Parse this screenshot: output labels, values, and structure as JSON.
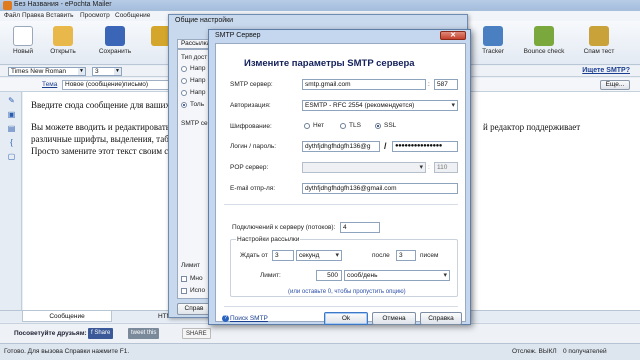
{
  "window": {
    "title": "Без Названия - ePochta Mailer"
  },
  "menu": [
    "Файл",
    "Правка",
    "Вставить",
    "Просмотр",
    "Сообщение"
  ],
  "toolbar": {
    "new": "Новый",
    "open": "Открыть",
    "save": "Сохранить",
    "tracker": "Tracker",
    "bounce_check": "Bounce check",
    "spam_check": "Спам тест"
  },
  "fontbar": {
    "font": "Times New Roman",
    "size": "3",
    "help": "Ищете SMTP?"
  },
  "subject": {
    "label": "Тема",
    "value": "Новое (сообщение)письмо)",
    "more": "Еще..."
  },
  "editor": {
    "line1": "Введите сюда сообщение для ваших",
    "line2": "Вы можете вводить и редактировать",
    "line2b": "й редактор поддерживает",
    "line3": "различные шрифты, выделения, табл",
    "line4": "Просто замените этот текст своим се"
  },
  "bottom_tabs": [
    "Сообщение",
    "HTM"
  ],
  "share": {
    "label": "Посоветуйте друзьям:",
    "facebook": "Share",
    "twitter": "tweet this",
    "addthis": "SHARE"
  },
  "status": {
    "left": "Готово. Для вызова Справки нажмите F1.",
    "mid": "Отслеж. ВЫКЛ",
    "right": "0 получателей"
  },
  "general_dialog": {
    "title": "Общие настройки",
    "tab": "Рассылка",
    "group": "Тип дост",
    "options": [
      "Напр",
      "Напр",
      "Напр",
      "Толь"
    ],
    "smtp_label": "SMTP серв",
    "limit_label": "Лимит",
    "checkboxes": [
      "Мно",
      "Испо"
    ],
    "button": "Справ"
  },
  "smtp_dialog": {
    "title": "SMTP Сервер",
    "heading": "Измените параметры SMTP сервера",
    "server_label": "SMTP сервер:",
    "server_value": "smtp.gmail.com",
    "port_value": "587",
    "auth_label": "Авторизация:",
    "auth_value": "ESMTP - RFC 2554 (рекомендуется)",
    "encryption_label": "Шифрование:",
    "encryption_options": [
      "Нет",
      "TLS",
      "SSL"
    ],
    "encryption_selected": "SSL",
    "login_label": "Логин / пароль:",
    "login_value": "dythfjdhgfhdgfh136@g",
    "password_value": "●●●●●●●●●●●●●●●",
    "pop_label": "POP сервер:",
    "pop_port": "110",
    "email_label": "E-mail отпр-ля:",
    "email_value": "dythfjdhgfhdgfh136@gmail.com",
    "connections_label": "Подключений к серверу (потоков):",
    "connections_value": "4",
    "mailing_group": "Настройки рассылки",
    "wait_label": "Ждать от",
    "wait_value": "3",
    "wait_unit": "секунд",
    "after_label": "после",
    "after_value": "3",
    "after_unit": "писем",
    "limit_label": "Лимит:",
    "limit_value": "500",
    "limit_unit": "сооб/день",
    "hint": "(или оставьте 0, чтобы пропустить опцию)",
    "search_link": "Поиск SMTP",
    "ok": "Ok",
    "cancel": "Отмена",
    "help": "Справка"
  }
}
